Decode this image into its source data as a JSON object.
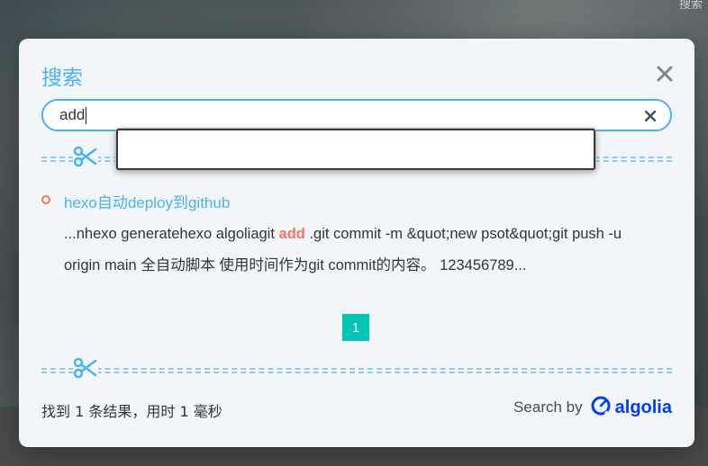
{
  "background": {
    "corner_text": "搜索"
  },
  "modal": {
    "title": "搜索",
    "search": {
      "value": "add",
      "placeholder": ""
    },
    "results": [
      {
        "title": "hexo自动deploy到github",
        "content_before": "...nhexo generatehexo algoliagit ",
        "keyword": "add",
        "content_after": " .git commit -m &quot;new psot&quot;git push -u origin main 全自动脚本 使用时间作为git commit的内容。 123456789..."
      }
    ],
    "pagination": {
      "current": "1"
    },
    "stats": "找到 1 条结果，用时 1 毫秒",
    "powered_by": {
      "label": "Search by",
      "brand": "algolia"
    }
  },
  "colors": {
    "accent": "#49b1f5",
    "highlight": "#f47466",
    "pager": "#00c4b6",
    "algolia": "#003dff",
    "bullet": "#ec7a4f"
  },
  "icons": [
    "close-icon",
    "clear-icon",
    "scissors-icon",
    "algolia-icon"
  ]
}
